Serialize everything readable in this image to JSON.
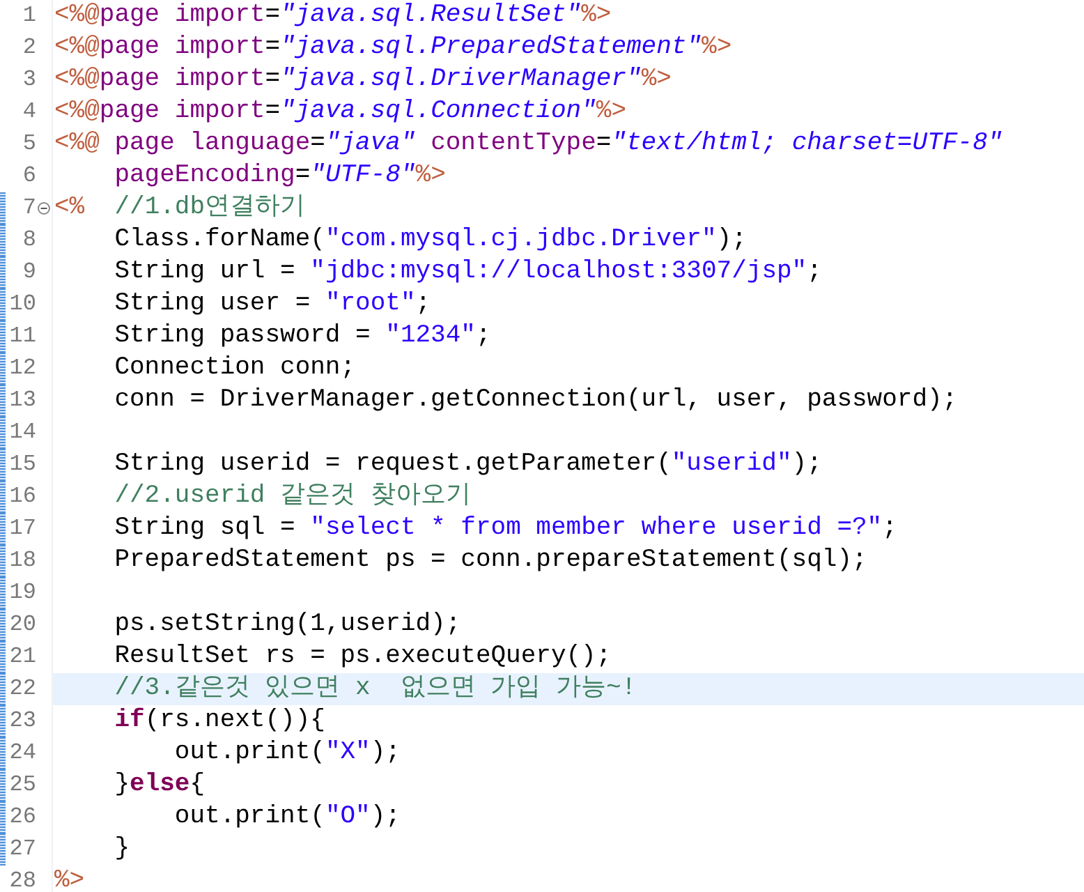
{
  "editor": {
    "lines": [
      {
        "number": "1",
        "changed": false,
        "tokens": [
          {
            "kind": "directive",
            "text": "<%@"
          },
          {
            "kind": "tag",
            "text": "page"
          },
          {
            "kind": "attr",
            "text": " import"
          },
          {
            "kind": "text",
            "text": "="
          },
          {
            "kind": "value",
            "text": "\"java.sql.ResultSet\""
          },
          {
            "kind": "directive",
            "text": "%>"
          }
        ]
      },
      {
        "number": "2",
        "changed": false,
        "tokens": [
          {
            "kind": "directive",
            "text": "<%@"
          },
          {
            "kind": "tag",
            "text": "page"
          },
          {
            "kind": "attr",
            "text": " import"
          },
          {
            "kind": "text",
            "text": "="
          },
          {
            "kind": "value",
            "text": "\"java.sql.PreparedStatement\""
          },
          {
            "kind": "directive",
            "text": "%>"
          }
        ]
      },
      {
        "number": "3",
        "changed": false,
        "tokens": [
          {
            "kind": "directive",
            "text": "<%@"
          },
          {
            "kind": "tag",
            "text": "page"
          },
          {
            "kind": "attr",
            "text": " import"
          },
          {
            "kind": "text",
            "text": "="
          },
          {
            "kind": "value",
            "text": "\"java.sql.DriverManager\""
          },
          {
            "kind": "directive",
            "text": "%>"
          }
        ]
      },
      {
        "number": "4",
        "changed": false,
        "tokens": [
          {
            "kind": "directive",
            "text": "<%@"
          },
          {
            "kind": "tag",
            "text": "page"
          },
          {
            "kind": "attr",
            "text": " import"
          },
          {
            "kind": "text",
            "text": "="
          },
          {
            "kind": "value",
            "text": "\"java.sql.Connection\""
          },
          {
            "kind": "directive",
            "text": "%>"
          }
        ]
      },
      {
        "number": "5",
        "changed": false,
        "tokens": [
          {
            "kind": "directive",
            "text": "<%@"
          },
          {
            "kind": "tag",
            "text": " page"
          },
          {
            "kind": "attr",
            "text": " language"
          },
          {
            "kind": "text",
            "text": "="
          },
          {
            "kind": "value",
            "text": "\"java\""
          },
          {
            "kind": "attr",
            "text": " contentType"
          },
          {
            "kind": "text",
            "text": "="
          },
          {
            "kind": "value",
            "text": "\"text/html; charset=UTF-8\""
          }
        ]
      },
      {
        "number": "6",
        "changed": false,
        "tokens": [
          {
            "kind": "attr",
            "text": "    pageEncoding"
          },
          {
            "kind": "text",
            "text": "="
          },
          {
            "kind": "value",
            "text": "\"UTF-8\""
          },
          {
            "kind": "directive",
            "text": "%>"
          }
        ]
      },
      {
        "number": "7",
        "changed": true,
        "foldable": true,
        "tokens": [
          {
            "kind": "directive",
            "text": "<%"
          },
          {
            "kind": "comment",
            "text": "  //1.db연결하기"
          }
        ]
      },
      {
        "number": "8",
        "changed": true,
        "tokens": [
          {
            "kind": "text",
            "text": "    Class.forName("
          },
          {
            "kind": "string",
            "text": "\"com.mysql.cj.jdbc.Driver\""
          },
          {
            "kind": "text",
            "text": ");"
          }
        ]
      },
      {
        "number": "9",
        "changed": true,
        "tokens": [
          {
            "kind": "text",
            "text": "    String url = "
          },
          {
            "kind": "string",
            "text": "\"jdbc:mysql://localhost:3307/jsp\""
          },
          {
            "kind": "text",
            "text": ";"
          }
        ]
      },
      {
        "number": "10",
        "changed": true,
        "tokens": [
          {
            "kind": "text",
            "text": "    String user = "
          },
          {
            "kind": "string",
            "text": "\"root\""
          },
          {
            "kind": "text",
            "text": ";"
          }
        ]
      },
      {
        "number": "11",
        "changed": true,
        "tokens": [
          {
            "kind": "text",
            "text": "    String password = "
          },
          {
            "kind": "string",
            "text": "\"1234\""
          },
          {
            "kind": "text",
            "text": ";"
          }
        ]
      },
      {
        "number": "12",
        "changed": true,
        "tokens": [
          {
            "kind": "text",
            "text": "    Connection conn;"
          }
        ]
      },
      {
        "number": "13",
        "changed": true,
        "tokens": [
          {
            "kind": "text",
            "text": "    conn = DriverManager.getConnection(url, user, password);"
          }
        ]
      },
      {
        "number": "14",
        "changed": true
      },
      {
        "number": "15",
        "changed": true,
        "tokens": [
          {
            "kind": "text",
            "text": "    String userid = request.getParameter("
          },
          {
            "kind": "string",
            "text": "\"userid\""
          },
          {
            "kind": "text",
            "text": ");"
          }
        ]
      },
      {
        "number": "16",
        "changed": true,
        "tokens": [
          {
            "kind": "comment",
            "text": "    //2.userid 같은것 찾아오기"
          }
        ]
      },
      {
        "number": "17",
        "changed": true,
        "tokens": [
          {
            "kind": "text",
            "text": "    String sql = "
          },
          {
            "kind": "string",
            "text": "\"select * from member where userid =?\""
          },
          {
            "kind": "text",
            "text": ";"
          }
        ]
      },
      {
        "number": "18",
        "changed": true,
        "tokens": [
          {
            "kind": "text",
            "text": "    PreparedStatement ps = conn.prepareStatement(sql);"
          }
        ]
      },
      {
        "number": "19",
        "changed": true
      },
      {
        "number": "20",
        "changed": true,
        "tokens": [
          {
            "kind": "text",
            "text": "    ps.setString(1,userid);"
          }
        ]
      },
      {
        "number": "21",
        "changed": true,
        "tokens": [
          {
            "kind": "text",
            "text": "    ResultSet rs = ps.executeQuery();"
          }
        ]
      },
      {
        "number": "22",
        "changed": true,
        "current": true,
        "tokens": [
          {
            "kind": "comment",
            "text": "    //3.같은것 있으면 x  없으면 가입 가능~!"
          }
        ]
      },
      {
        "number": "23",
        "changed": true,
        "tokens": [
          {
            "kind": "keyword",
            "text": "    if"
          },
          {
            "kind": "text",
            "text": "(rs.next()){"
          }
        ]
      },
      {
        "number": "24",
        "changed": true,
        "tokens": [
          {
            "kind": "text",
            "text": "        out.print("
          },
          {
            "kind": "string",
            "text": "\"X\""
          },
          {
            "kind": "text",
            "text": ");"
          }
        ]
      },
      {
        "number": "25",
        "changed": true,
        "tokens": [
          {
            "kind": "text",
            "text": "    }"
          },
          {
            "kind": "keyword",
            "text": "else"
          },
          {
            "kind": "text",
            "text": "{"
          }
        ]
      },
      {
        "number": "26",
        "changed": true,
        "tokens": [
          {
            "kind": "text",
            "text": "        out.print("
          },
          {
            "kind": "string",
            "text": "\"O\""
          },
          {
            "kind": "text",
            "text": ");"
          }
        ]
      },
      {
        "number": "27",
        "changed": true,
        "tokens": [
          {
            "kind": "text",
            "text": "    }"
          }
        ]
      },
      {
        "number": "28",
        "changed": false,
        "tokens": [
          {
            "kind": "directive",
            "text": "%>"
          }
        ]
      }
    ]
  }
}
